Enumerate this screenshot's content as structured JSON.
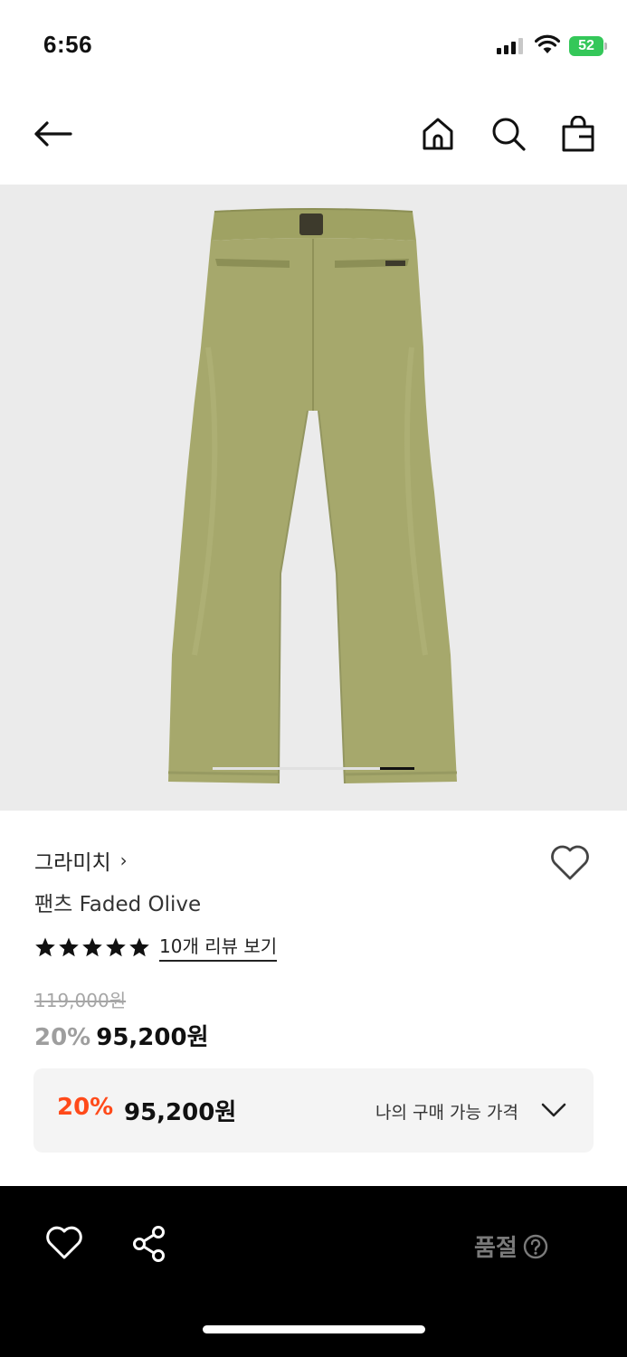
{
  "status_bar": {
    "time": "6:56",
    "battery": "52"
  },
  "nav": {
    "back_icon": "arrow-left-icon",
    "home_icon": "home-icon",
    "search_icon": "search-icon",
    "cart_icon": "shopping-bag-icon"
  },
  "product": {
    "image_alt": "Olive pants back view",
    "image_color": "#a7a96b",
    "gallery_position": "last",
    "brand": "그라미치",
    "brand_chevron": "›",
    "name": "팬츠 Faded Olive",
    "rating_stars": 5,
    "review_link": "10개 리뷰 보기",
    "original_price": "119,000원",
    "discount_rate": "20%",
    "sale_price": "95,200원"
  },
  "my_price": {
    "discount_rate": "20%",
    "price": "95,200원",
    "label": "나의 구매 가능 가격",
    "accent_color": "#ff4a1a"
  },
  "bottom_bar": {
    "wish_icon": "heart-icon",
    "share_icon": "share-icon",
    "soldout_label": "품절",
    "help_icon": "question-circle-icon"
  }
}
